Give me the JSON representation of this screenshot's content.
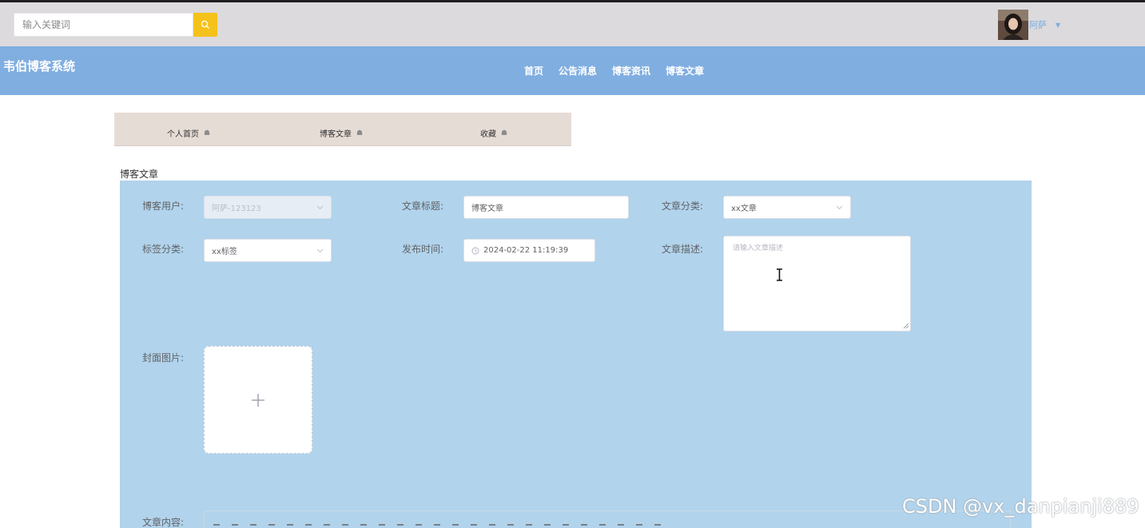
{
  "header": {
    "search_placeholder": "输入关键词",
    "user_name": "阿萨"
  },
  "navbar": {
    "site_title": "韦伯博客系统",
    "links": [
      "首页",
      "公告消息",
      "博客资讯",
      "博客文章"
    ]
  },
  "subnav": {
    "items": [
      "个人首页",
      "博客文章",
      "收藏"
    ]
  },
  "section_title": "博客文章",
  "form": {
    "user_label": "博客用户:",
    "user_value": "阿萨-123123",
    "title_label": "文章标题:",
    "title_value": "博客文章",
    "category_label": "文章分类:",
    "category_value": "xx文章",
    "tag_label": "标签分类:",
    "tag_value": "xx标签",
    "publish_label": "发布时间:",
    "publish_value": "2024-02-22 11:19:39",
    "desc_label": "文章描述:",
    "desc_placeholder": "请输入文章描述",
    "cover_label": "封面图片:",
    "content_label": "文章内容:"
  },
  "watermark": "CSDN @vx_danpianji889",
  "colors": {
    "navbar": "#80aee0",
    "search_button": "#f5c21b",
    "form_panel": "#b1d3ec",
    "subnav": "#e6dcd6"
  }
}
